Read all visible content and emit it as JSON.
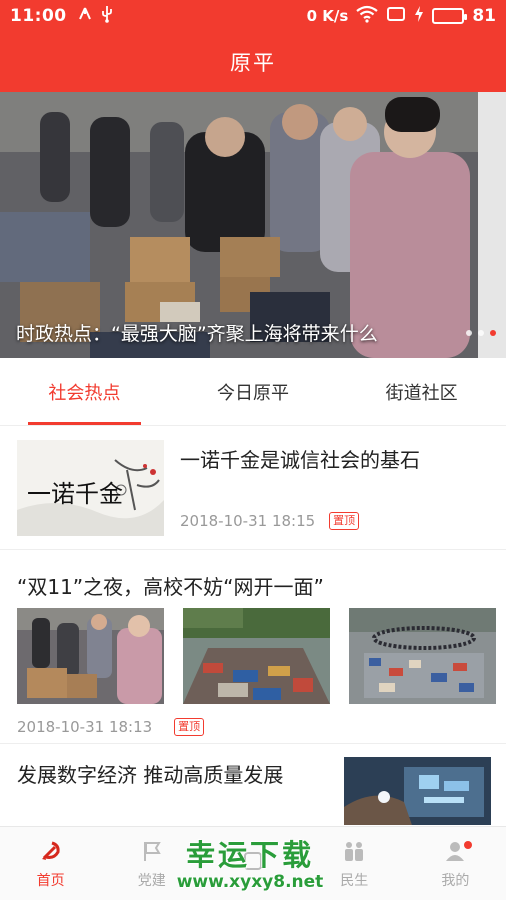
{
  "status_bar": {
    "time": "11:00",
    "network_speed": "0 K/s",
    "battery_level": "81",
    "battery_color": "#3ddc4a"
  },
  "header": {
    "title": "原平"
  },
  "banner": {
    "caption": "时政热点：“最强大脑”齐聚上海将带来什么",
    "slide_count": 3,
    "active_slide": 3
  },
  "tabs": [
    {
      "label": "社会热点",
      "active": true
    },
    {
      "label": "今日原平",
      "active": false
    },
    {
      "label": "街道社区",
      "active": false
    }
  ],
  "articles": [
    {
      "headline": "一诺千金是诚信社会的基石",
      "date": "2018-10-31 18:15",
      "badge": "置顶",
      "thumb_text": "一诺千金"
    },
    {
      "headline": "“双11”之夜，高校不妨“网开一面”",
      "date": "2018-10-31 18:13",
      "badge": "置顶"
    },
    {
      "headline": "发展数字经济 推动高质量发展"
    }
  ],
  "bottom_nav": [
    {
      "label": "首页",
      "icon": "party-emblem-icon",
      "active": true
    },
    {
      "label": "党建",
      "icon": "flag-icon",
      "active": false
    },
    {
      "label": "",
      "icon": "center-icon",
      "active": false
    },
    {
      "label": "民生",
      "icon": "people-icon",
      "active": false
    },
    {
      "label": "我的",
      "icon": "user-icon",
      "active": false
    }
  ],
  "watermark": {
    "main": "幸运下载",
    "url": "www.xyxy8.net"
  },
  "colors": {
    "brand_red": "#f23b2f",
    "text_primary": "#222222",
    "text_muted": "#999999"
  }
}
